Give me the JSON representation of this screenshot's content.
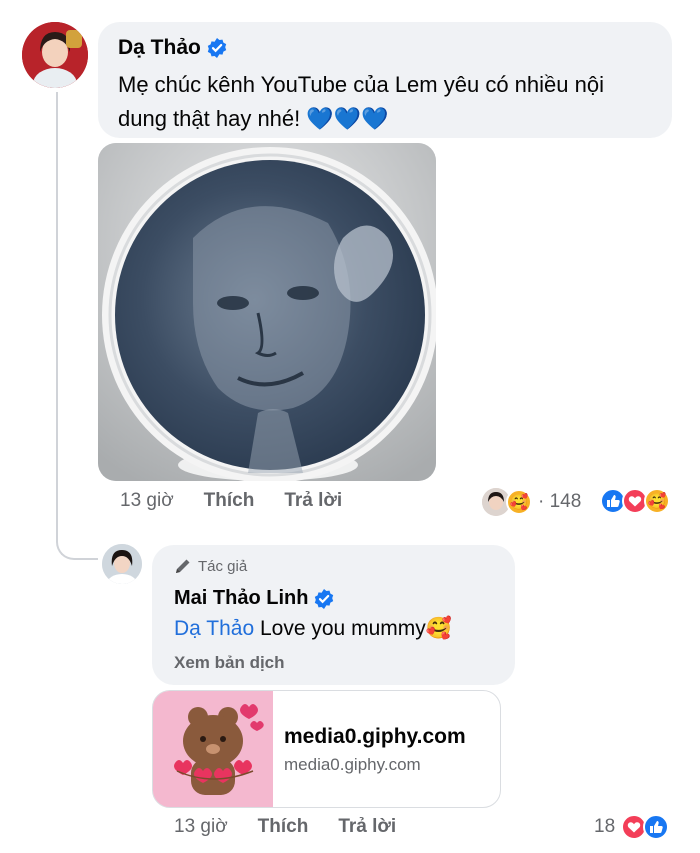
{
  "comment1": {
    "author": "Dạ Thảo",
    "text": "Mẹ chúc kênh YouTube của Lem yêu có nhiều nội dung thật hay nhé! 💙💙💙",
    "time": "13 giờ",
    "like_label": "Thích",
    "reply_label": "Trả lời",
    "reaction_count": "· 148"
  },
  "reply1": {
    "badge": "Tác giả",
    "author": "Mai Thảo Linh",
    "mention": "Dạ Thảo",
    "text": " Love you mummy🥰",
    "translate_label": "Xem bản dịch",
    "link_title": "media0.giphy.com",
    "link_domain": "media0.giphy.com",
    "time": "13 giờ",
    "like_label": "Thích",
    "reply_label": "Trả lời",
    "reaction_count": "18"
  },
  "colors": {
    "bubble": "#f0f2f5",
    "meta_text": "#65676b",
    "mention": "#216fdb",
    "like_blue": "#1877f2",
    "love_red": "#f33e58"
  },
  "icons": [
    "verified-badge-icon",
    "pen-icon",
    "like-reaction-icon",
    "love-reaction-icon",
    "care-reaction-icon"
  ]
}
